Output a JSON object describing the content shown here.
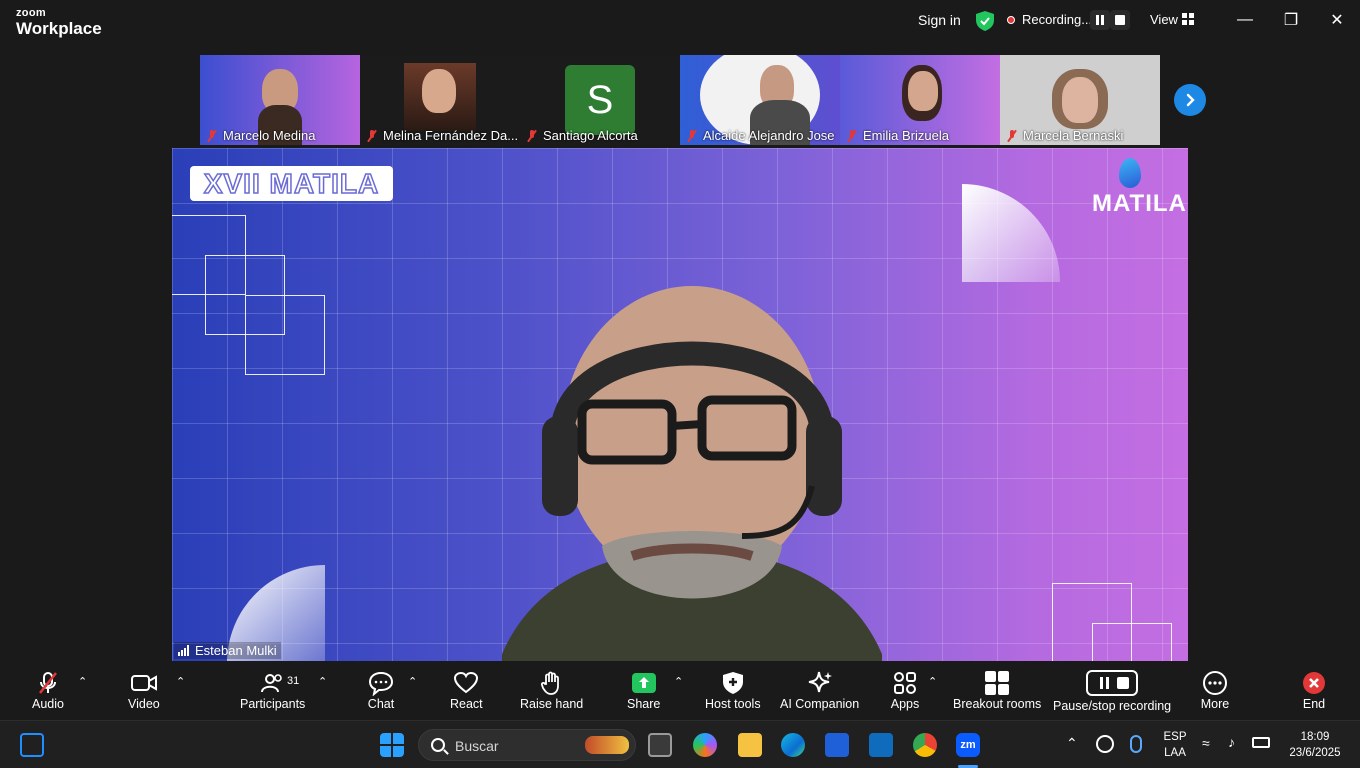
{
  "titlebar": {
    "brand_small": "zoom",
    "brand_big": "Workplace",
    "sign_in": "Sign in",
    "recording": "Recording...",
    "view": "View"
  },
  "thumbnails": [
    {
      "name": "Marcelo Medina"
    },
    {
      "name": "Melina Fernández Da..."
    },
    {
      "name": "Santiago Alcorta",
      "initial": "S"
    },
    {
      "name": "Alcaide Alejandro Jose"
    },
    {
      "name": "Emilia Brizuela"
    },
    {
      "name": "Marcela Bernaski"
    }
  ],
  "main": {
    "banner": "XVII MATILA",
    "logo_word": "MATILA",
    "speaker": "Esteban Mulki"
  },
  "toolbar": {
    "audio": "Audio",
    "video": "Video",
    "participants": "Participants",
    "participants_count": "31",
    "chat": "Chat",
    "react": "React",
    "raise_hand": "Raise hand",
    "share": "Share",
    "host_tools": "Host tools",
    "ai_companion": "AI Companion",
    "apps": "Apps",
    "breakout_rooms": "Breakout rooms",
    "pause_stop_recording": "Pause/stop recording",
    "more": "More",
    "end": "End"
  },
  "taskbar": {
    "search_placeholder": "Buscar",
    "lang_top": "ESP",
    "lang_bottom": "LAA",
    "time": "18:09",
    "date": "23/6/2025"
  },
  "colors": {
    "accent_blue": "#1e88e5",
    "share_green": "#22c55e",
    "recording_red": "#e23838",
    "avatar_green": "#2e7d32"
  }
}
